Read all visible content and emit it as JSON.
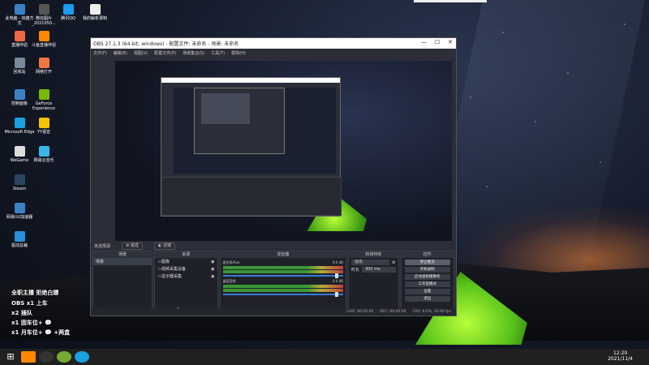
{
  "desktop": {
    "icons": [
      {
        "label": "此电脑 - 快捷方式",
        "color": "#3b82c4"
      },
      {
        "label": "微信图片_2021050...",
        "color": "#555"
      },
      {
        "label": "腾讯QQ",
        "color": "#1d9bf0"
      },
      {
        "label": "我的解析录制",
        "color": "#eee"
      },
      {
        "label": "直播伴侣",
        "color": "#e64"
      },
      {
        "label": "斗鱼直播伴侣",
        "color": "#f80"
      },
      {
        "label": "回收站",
        "color": "#789"
      },
      {
        "label": "网络打开",
        "color": "#e74"
      },
      {
        "label": "控制面板",
        "color": "#3b82c4"
      },
      {
        "label": "GeForce Experience",
        "color": "#76b900"
      },
      {
        "label": "Microsoft Edge",
        "color": "#1aa1e0"
      },
      {
        "label": "YY语音",
        "color": "#f5c200"
      },
      {
        "label": "WeGame",
        "color": "#ddd"
      },
      {
        "label": "网易云音乐",
        "color": "#3ab6e8"
      },
      {
        "label": "Steam",
        "color": "#2a475e"
      },
      {
        "label": "网易UU加速器",
        "color": "#3b82c4"
      },
      {
        "label": "驱动总裁",
        "color": "#2a8fd8"
      }
    ],
    "overlay_lines": [
      "全职主播  拒绝白嫖",
      "OBS x1 上车",
      "x2 插队",
      "x1 固车位+ 💬",
      "x1 月车位+ 💬 +两盒"
    ]
  },
  "obs": {
    "title": "OBS 27.1.3 (64-bit, windows) - 配置文件: 未命名 - 场景: 未命名",
    "menu": [
      "文件(F)",
      "编辑(E)",
      "视图(V)",
      "配置文件(P)",
      "场景集合(S)",
      "工具(T)",
      "帮助(H)"
    ],
    "source_bar": {
      "label": "未选择源",
      "props": "属性",
      "filters": "滤镜"
    },
    "scenes": {
      "header": "场景",
      "items": [
        "场景"
      ]
    },
    "sources": {
      "header": "来源",
      "items": [
        "图像",
        "视频采集设备",
        "显示器采集"
      ]
    },
    "mixer": {
      "header": "混音器",
      "channels": [
        {
          "name": "麦克风/Aux",
          "db": "0.0 dB"
        },
        {
          "name": "桌面音频",
          "db": "0.0 dB"
        }
      ]
    },
    "transitions": {
      "header": "转场特效",
      "type": "淡出",
      "duration_label": "时长",
      "duration": "300 ms"
    },
    "controls": {
      "header": "控件",
      "buttons": [
        "停止推流",
        "开始录制",
        "启动虚拟摄像机",
        "工作室模式",
        "设置",
        "退出"
      ]
    },
    "status": {
      "live": "LIVE: 00:00:00",
      "rec": "REC: 00:00:00",
      "cpu": "CPU: 0.6%, 30.00 fps"
    }
  },
  "taskbar": {
    "time": "12:20",
    "date": "2021/11/4"
  }
}
